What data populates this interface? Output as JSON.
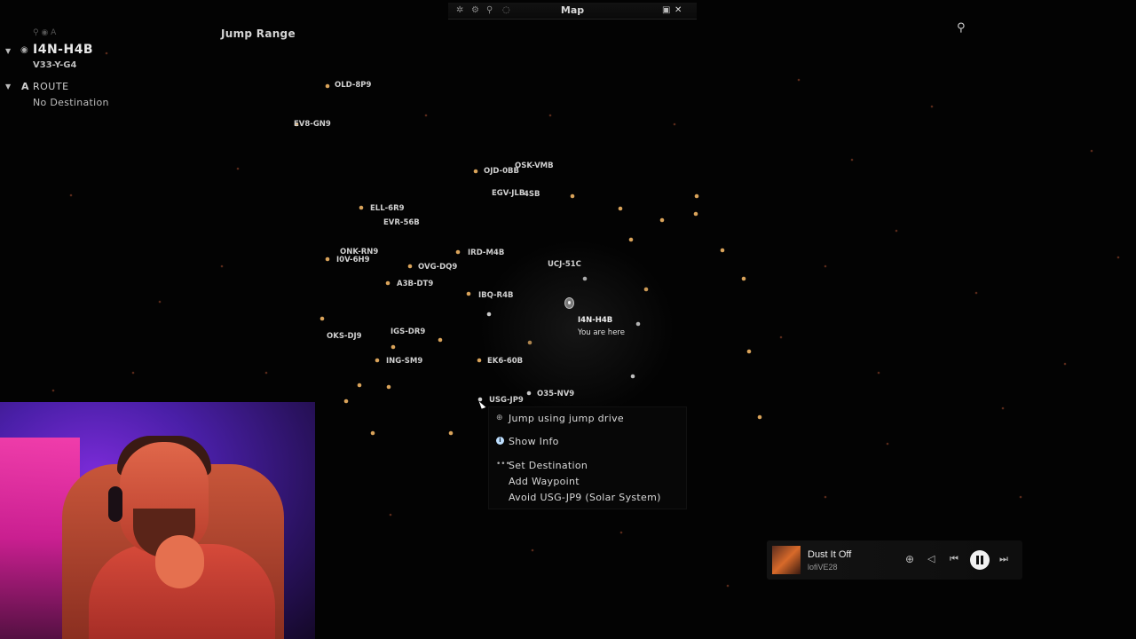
{
  "window": {
    "title": "Map"
  },
  "left_panel": {
    "filter_glyphs": "⚲ ◉ A",
    "current_system": "I4N-H4B",
    "constellation": "V33-Y-G4",
    "route_prefix": "A",
    "route_label": "ROUTE",
    "route_value": "No Destination"
  },
  "jump_range_label": "Jump Range",
  "systems": [
    {
      "name": "OLD-8P9"
    },
    {
      "name": "EV8-GN9"
    },
    {
      "name": "OSK-VMB"
    },
    {
      "name": "OJD-0BB"
    },
    {
      "name": "EGV-JLB"
    },
    {
      "name": "4SB"
    },
    {
      "name": "ELL-6R9"
    },
    {
      "name": "EVR-56B"
    },
    {
      "name": "ONK-RN9"
    },
    {
      "name": "I0V-6H9"
    },
    {
      "name": "OVG-DQ9"
    },
    {
      "name": "IRD-M4B"
    },
    {
      "name": "UCJ-51C"
    },
    {
      "name": "A3B-DT9"
    },
    {
      "name": "IBQ-R4B"
    },
    {
      "name": "OKS-DJ9"
    },
    {
      "name": "IGS-DR9"
    },
    {
      "name": "ING-SM9"
    },
    {
      "name": "EK6-60B"
    },
    {
      "name": "O35-NV9"
    },
    {
      "name": "USG-JP9"
    }
  ],
  "current_location": {
    "name": "I4N-H4B",
    "note": "You are here"
  },
  "context_menu": {
    "items": [
      {
        "label": "Jump using jump drive",
        "icon": "jump-drive-icon"
      },
      {
        "label": "Show Info",
        "icon": "info-icon"
      },
      {
        "label": "Set Destination",
        "icon": "destination-icon"
      },
      {
        "label": "Add Waypoint",
        "icon": ""
      },
      {
        "label": "Avoid USG-JP9 (Solar System)",
        "icon": ""
      }
    ]
  },
  "music_player": {
    "title": "Dust It Off",
    "artist": "lofiVE28"
  },
  "colors": {
    "star_orange": "#d9a35a",
    "star_white": "#cfcfcf",
    "background": "#030303"
  }
}
